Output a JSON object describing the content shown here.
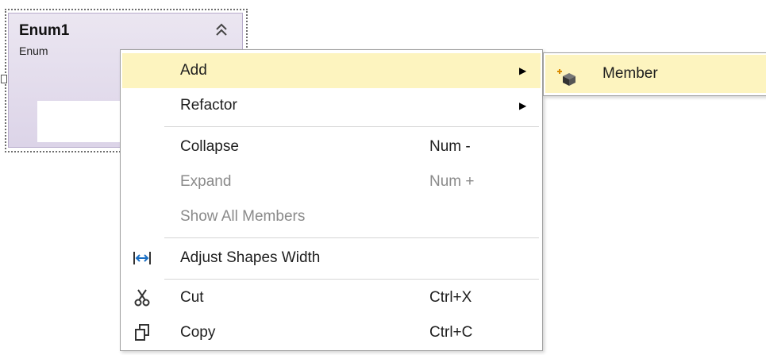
{
  "shape": {
    "title": "Enum1",
    "subtitle": "Enum",
    "collapse_glyph": "»"
  },
  "menu": {
    "items": [
      {
        "label": "Add",
        "shortcut": "",
        "has_submenu": true,
        "highlighted": true,
        "disabled": false,
        "icon": ""
      },
      {
        "label": "Refactor",
        "shortcut": "",
        "has_submenu": true,
        "highlighted": false,
        "disabled": false,
        "icon": ""
      },
      {
        "label": "Collapse",
        "shortcut": "Num -",
        "has_submenu": false,
        "highlighted": false,
        "disabled": false,
        "icon": ""
      },
      {
        "label": "Expand",
        "shortcut": "Num +",
        "has_submenu": false,
        "highlighted": false,
        "disabled": true,
        "icon": ""
      },
      {
        "label": "Show All Members",
        "shortcut": "",
        "has_submenu": false,
        "highlighted": false,
        "disabled": true,
        "icon": ""
      },
      {
        "label": "Adjust Shapes Width",
        "shortcut": "",
        "has_submenu": false,
        "highlighted": false,
        "disabled": false,
        "icon": "adjust-width-icon"
      },
      {
        "label": "Cut",
        "shortcut": "Ctrl+X",
        "has_submenu": false,
        "highlighted": false,
        "disabled": false,
        "icon": "scissors-icon"
      },
      {
        "label": "Copy",
        "shortcut": "Ctrl+C",
        "has_submenu": false,
        "highlighted": false,
        "disabled": false,
        "icon": "copy-icon"
      }
    ],
    "arrow_glyph": "▶"
  },
  "submenu": {
    "items": [
      {
        "label": "Member",
        "icon": "add-member-icon",
        "highlighted": true
      }
    ]
  },
  "colors": {
    "highlight": "#fdf4bf",
    "shape_bg": "#dcd4e8",
    "disabled_text": "#8a8a8a",
    "icon_blue": "#1a6fc4"
  }
}
